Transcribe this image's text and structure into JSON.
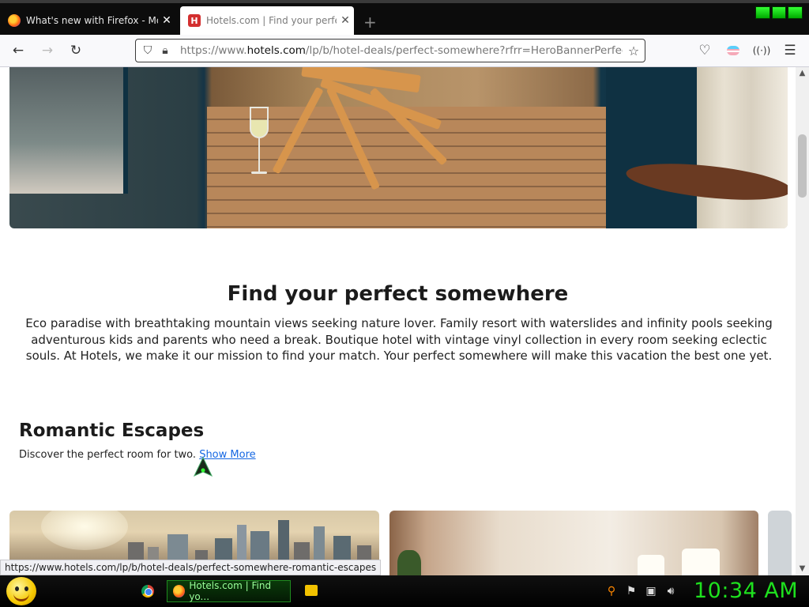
{
  "browser": {
    "tabs": [
      {
        "title": "What's new with Firefox - More"
      },
      {
        "title": "Hotels.com | Find your perfect"
      }
    ],
    "new_tab": "+",
    "url_prefix": "https://www.",
    "url_domain": "hotels.com",
    "url_path": "/lp/b/hotel-deals/perfect-somewhere?rfrr=HeroBannerPerfectSome",
    "status_link": "https://www.hotels.com/lp/b/hotel-deals/perfect-somewhere-romantic-escapes"
  },
  "page": {
    "heading": "Find your perfect somewhere",
    "intro": "Eco paradise with breathtaking mountain views seeking nature lover. Family resort with waterslides and infinity pools seeking adventurous kids and parents who need a break.  Boutique hotel with vintage vinyl collection in every room seeking eclectic souls. At Hotels, we make it our mission to find your match. Your perfect somewhere will make this vacation the best one yet.",
    "section_title": "Romantic Escapes",
    "section_sub": "Discover the perfect room for two.",
    "show_more": "Show More"
  },
  "taskbar": {
    "task_label": "Hotels.com | Find yo...",
    "clock": "10:34 AM"
  },
  "colors": {
    "link": "#1668e3",
    "clock": "#1ee01e"
  }
}
